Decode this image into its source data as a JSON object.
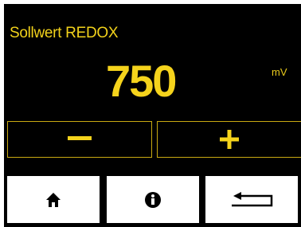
{
  "screen": {
    "title": "Sollwert REDOX",
    "value": "750",
    "unit": "mV"
  },
  "controls": {
    "decrease_icon": "minus-icon",
    "increase_icon": "plus-icon"
  },
  "nav": {
    "home_icon": "home-icon",
    "info_icon": "info-icon",
    "back_icon": "return-icon"
  },
  "colors": {
    "background": "#000000",
    "accent": "#f5d31c",
    "button_border": "#c9a912",
    "nav_button": "#ffffff"
  }
}
